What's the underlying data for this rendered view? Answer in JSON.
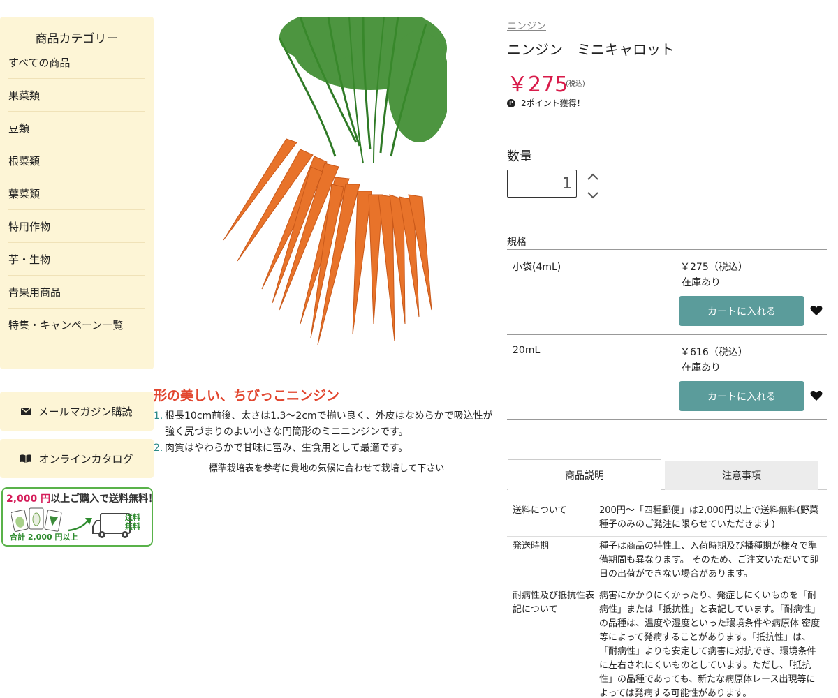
{
  "sidebar": {
    "category_title": "商品カテゴリー",
    "categories": [
      "すべての商品",
      "果菜類",
      "豆類",
      "根菜類",
      "葉菜類",
      "特用作物",
      "芋・生物",
      "青果用商品",
      "特集・キャンペーン一覧"
    ],
    "mail_magazine": "メールマガジン購読",
    "online_catalog": "オンラインカタログ",
    "shipping_banner": {
      "amount": "2,000 円",
      "text": "以上ご購入で送料無料！",
      "total_note": "合計 2,000 円以上",
      "truck_text": "送料無料"
    }
  },
  "description": {
    "title": "形の美しい、ちびっこニンジン",
    "points": [
      "根長10cm前後、太さは1.3〜2cmで揃い良く、外皮はなめらかで吸込性が強く尻づまりのよい小さな円筒形のミニニンジンです。",
      "肉質はやわらかで甘味に富み、生食用として最適です。"
    ],
    "note": "標準栽培表を参考に貴地の気候に合わせて栽培して下さい"
  },
  "product": {
    "breadcrumb": "ニンジン",
    "title": "ニンジン　ミニキャロット",
    "price": "￥275",
    "price_tax": "(税込)",
    "points_badge": "P",
    "points": "2ポイント獲得！",
    "quantity_label": "数量",
    "quantity_value": "1",
    "spec_label": "規格",
    "variants": [
      {
        "name": "小袋(4mL)",
        "price": "￥275（税込）",
        "stock": "在庫あり",
        "cart": "カートに入れる"
      },
      {
        "name": "20mL",
        "price": "￥616（税込）",
        "stock": "在庫あり",
        "cart": "カートに入れる"
      }
    ]
  },
  "tabs": [
    "商品説明",
    "注意事項"
  ],
  "info": [
    {
      "key": "送料について",
      "value": "200円〜「四種郵便」は2,000円以上で送料無料(野菜種子のみのご発注に限らせていただきます)"
    },
    {
      "key": "発送時期",
      "value": "種子は商品の特性上、入荷時期及び播種期が様々で準備期間も異なります。 そのため、ご注文いただいて即日の出荷ができない場合があります。"
    },
    {
      "key": "耐病性及び抵抗性表記について",
      "value": "病害にかかりにくかったり、発症しにくいものを「耐病性」または「抵抗性」と表記しています。「耐病性」の品種は、温度や湿度といった環境条件や病原体 密度等によって発病することがあります。「抵抗性」は、「耐病性」よりも安定して病害に対抗でき、環境条件に左右されにくいものとしています。ただし、「抵抗性」の品種であっても、新たな病原体レース出現等によっては発病する可能性があります。"
    }
  ],
  "colors": {
    "sidebar_bg": "#fdf5d6",
    "price": "#d81b4a",
    "accent_title": "#e2462f",
    "cart_button": "#5b9c9b",
    "list_number": "#2c8a87"
  }
}
